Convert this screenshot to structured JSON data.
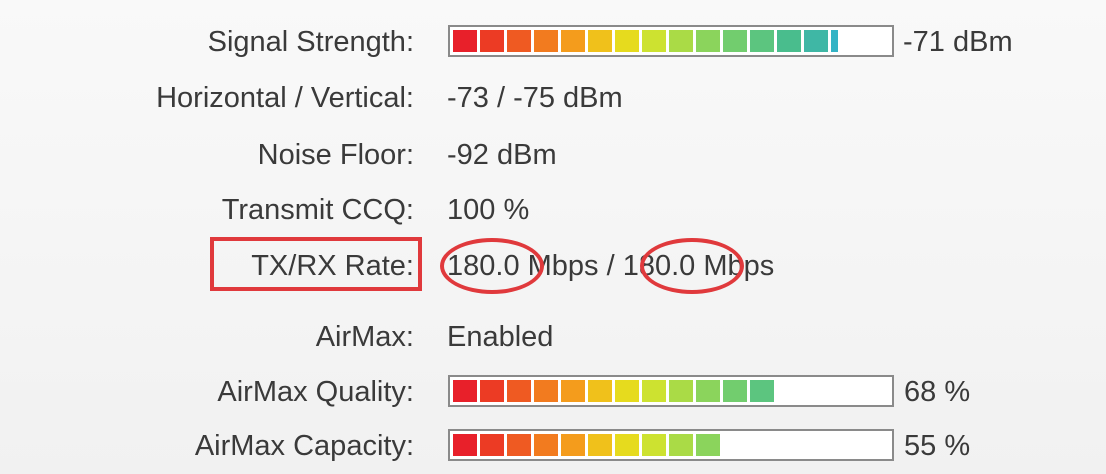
{
  "signal": {
    "label": "Signal Strength:",
    "value_text": "-71 dBm",
    "level": 0.84,
    "colors": [
      "#e8202a",
      "#ec3b24",
      "#ef5a22",
      "#f27b1f",
      "#f49c1c",
      "#f0c11b",
      "#e6db1e",
      "#cde230",
      "#aadb46",
      "#8bd45c",
      "#72cd6e",
      "#5cc57f",
      "#49bd8d",
      "#3fb7a5",
      "#33b3c5"
    ]
  },
  "horizontal_vertical": {
    "label": "Horizontal / Vertical:",
    "value": "-73 / -75 dBm"
  },
  "noise_floor": {
    "label": "Noise Floor:",
    "value": "-92 dBm"
  },
  "transmit_ccq": {
    "label": "Transmit CCQ:",
    "value": "100 %"
  },
  "txrx": {
    "label": "TX/RX Rate:",
    "tx_value": "180.0",
    "unit1": " Mbps / ",
    "rx_value": "180.0",
    "unit2": " Mbps"
  },
  "airmax": {
    "label": "AirMax:",
    "value": "Enabled"
  },
  "airmax_quality": {
    "label": "AirMax Quality:",
    "value_text": "68 %",
    "level": 0.68,
    "colors": [
      "#e8202a",
      "#ec3b24",
      "#ef5a22",
      "#f27b1f",
      "#f49c1c",
      "#f0c11b",
      "#e6db1e",
      "#cde230",
      "#aadb46",
      "#8bd45c",
      "#72cd6e",
      "#5cc57f"
    ]
  },
  "airmax_capacity": {
    "label": "AirMax Capacity:",
    "value_text": "55 %",
    "level": 0.55,
    "colors": [
      "#e8202a",
      "#ec3b24",
      "#ef5a22",
      "#f27b1f",
      "#f49c1c",
      "#f0c11b",
      "#e6db1e",
      "#cde230",
      "#aadb46",
      "#8bd45c"
    ]
  },
  "annotation_color": "#e0393c"
}
